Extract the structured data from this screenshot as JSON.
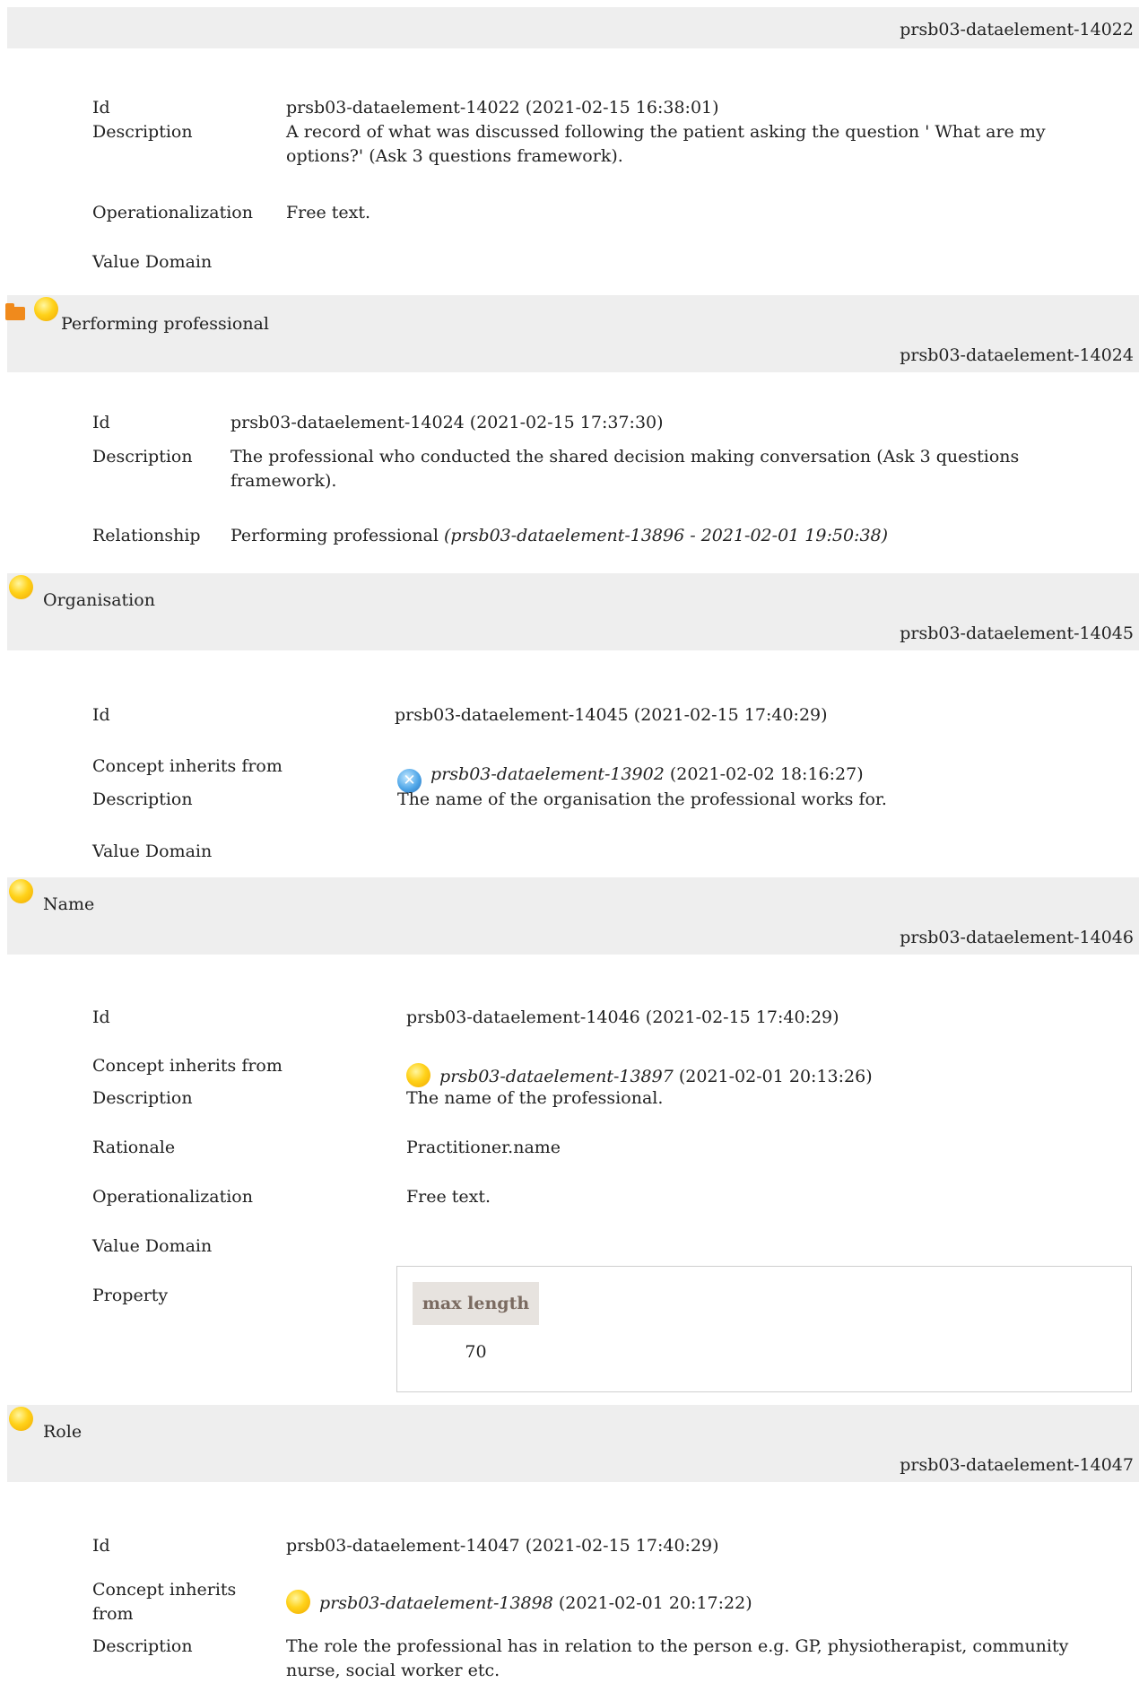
{
  "sections": [
    {
      "header_id": "prsb03-dataelement-14022",
      "rows": [
        {
          "label": "Id",
          "value": "prsb03-dataelement-14022 (2021-02-15 16:38:01)"
        },
        {
          "label": "Description",
          "value": "A record of what was discussed following the patient asking the question ' What are my options?' (Ask 3 questions framework)."
        },
        {
          "label": "Operationalization",
          "value": "Free text."
        },
        {
          "label": "Value Domain",
          "value": ""
        }
      ]
    },
    {
      "title": "Performing professional",
      "header_id": "prsb03-dataelement-14024",
      "rows": [
        {
          "label": "Id",
          "value": "prsb03-dataelement-14024 (2021-02-15 17:37:30)"
        },
        {
          "label": "Description",
          "value": "The professional who conducted the shared decision making conversation (Ask 3 questions framework)."
        },
        {
          "label": "Relationship",
          "value": "Performing professional",
          "value_italic": "(prsb03-dataelement-13896 - 2021-02-01 19:50:38)"
        }
      ]
    },
    {
      "title": "Organisation",
      "header_id": "prsb03-dataelement-14045",
      "rows": [
        {
          "label": "Id",
          "value": "prsb03-dataelement-14045 (2021-02-15 17:40:29)"
        },
        {
          "label": "Concept inherits from",
          "value_italic": "prsb03-dataelement-13902",
          "value": "(2021-02-02 18:16:27)"
        },
        {
          "label": "Description",
          "value": "The name of the organisation the professional works for."
        },
        {
          "label": "Value Domain",
          "value": ""
        }
      ]
    },
    {
      "title": "Name",
      "header_id": "prsb03-dataelement-14046",
      "rows": [
        {
          "label": "Id",
          "value": "prsb03-dataelement-14046 (2021-02-15 17:40:29)"
        },
        {
          "label": "Concept inherits from",
          "value_italic": "prsb03-dataelement-13897",
          "value": "(2021-02-01 20:13:26)"
        },
        {
          "label": "Description",
          "value": "The name of the professional."
        },
        {
          "label": "Rationale",
          "value": "Practitioner.name"
        },
        {
          "label": "Operationalization",
          "value": "Free text."
        },
        {
          "label": "Value Domain",
          "value": ""
        },
        {
          "label": "Property",
          "value": ""
        }
      ],
      "property": {
        "header": "max length",
        "value": "70"
      }
    },
    {
      "title": "Role",
      "header_id": "prsb03-dataelement-14047",
      "rows": [
        {
          "label": "Id",
          "value": "prsb03-dataelement-14047 (2021-02-15 17:40:29)"
        },
        {
          "label": "Concept inherits from",
          "value_italic": "prsb03-dataelement-13898",
          "value": "(2021-02-01 20:17:22)"
        },
        {
          "label": "Description",
          "value": "The role the professional has in relation to the person e.g. GP, physiotherapist, community nurse, social worker etc."
        }
      ]
    }
  ],
  "icons": {
    "folder": "folder-open-icon",
    "concept": "yellow-ball-icon",
    "cancelled": "blue-x-icon"
  }
}
